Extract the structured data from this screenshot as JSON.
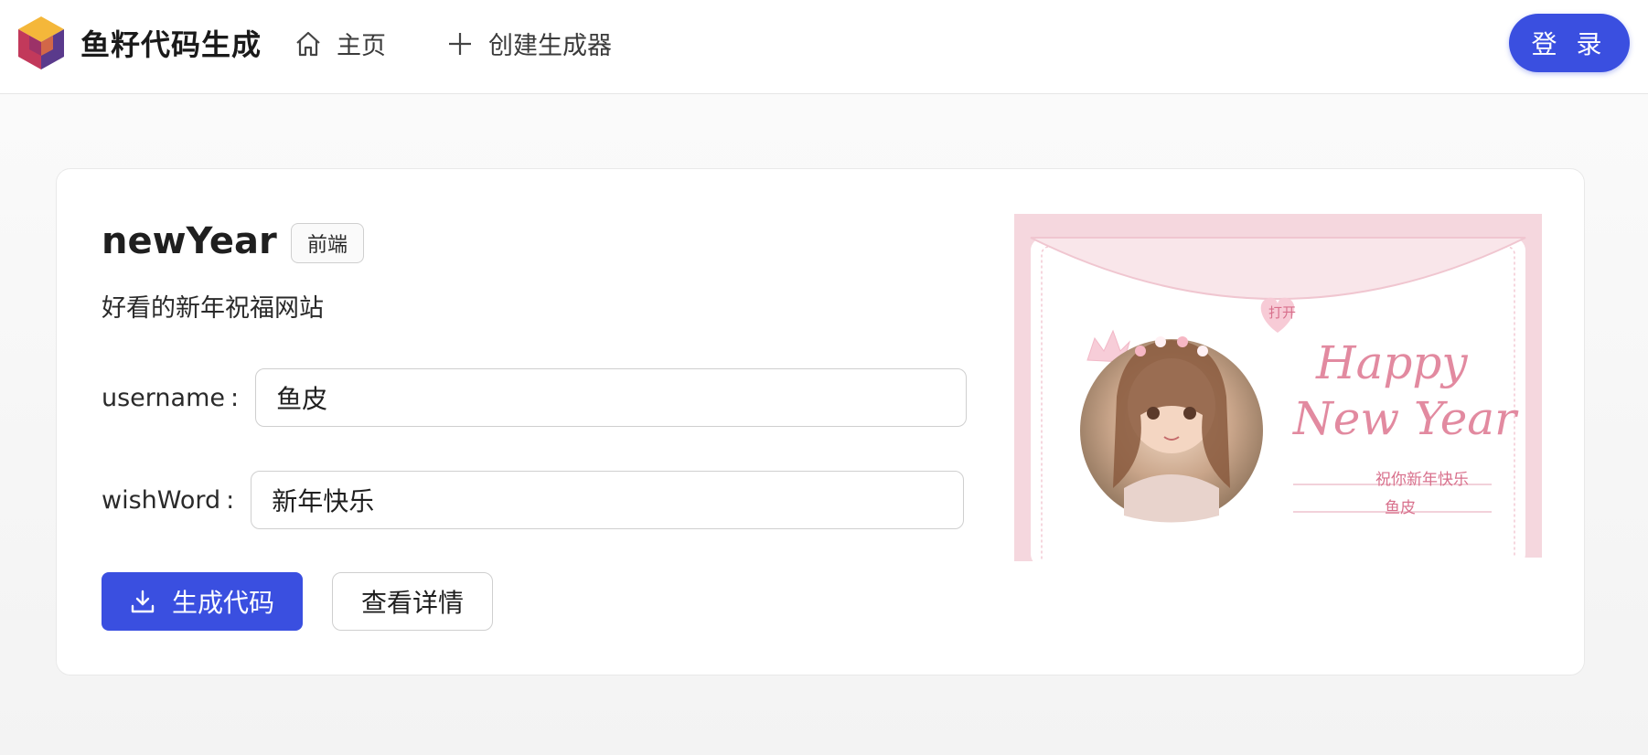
{
  "header": {
    "site_title": "鱼籽代码生成",
    "nav": [
      {
        "label": "主页",
        "icon": "home-icon"
      },
      {
        "label": "创建生成器",
        "icon": "plus-icon"
      }
    ],
    "login_label": "登 录"
  },
  "generator": {
    "name": "newYear",
    "tag": "前端",
    "description": "好看的新年祝福网站",
    "fields": [
      {
        "label": "username",
        "value": "鱼皮"
      },
      {
        "label": "wishWord",
        "value": "新年快乐"
      }
    ],
    "colon": ":",
    "generate_label": "生成代码",
    "detail_label": "查看详情"
  },
  "preview": {
    "open_text": "打开",
    "happy_text": "Happy",
    "new_year_text": "New Year",
    "wish_text": "祝你新年快乐",
    "name_text": "鱼皮"
  },
  "colors": {
    "primary": "#3a4fe0",
    "preview_pink": "#f5d7de",
    "preview_text": "#e28aa0"
  }
}
